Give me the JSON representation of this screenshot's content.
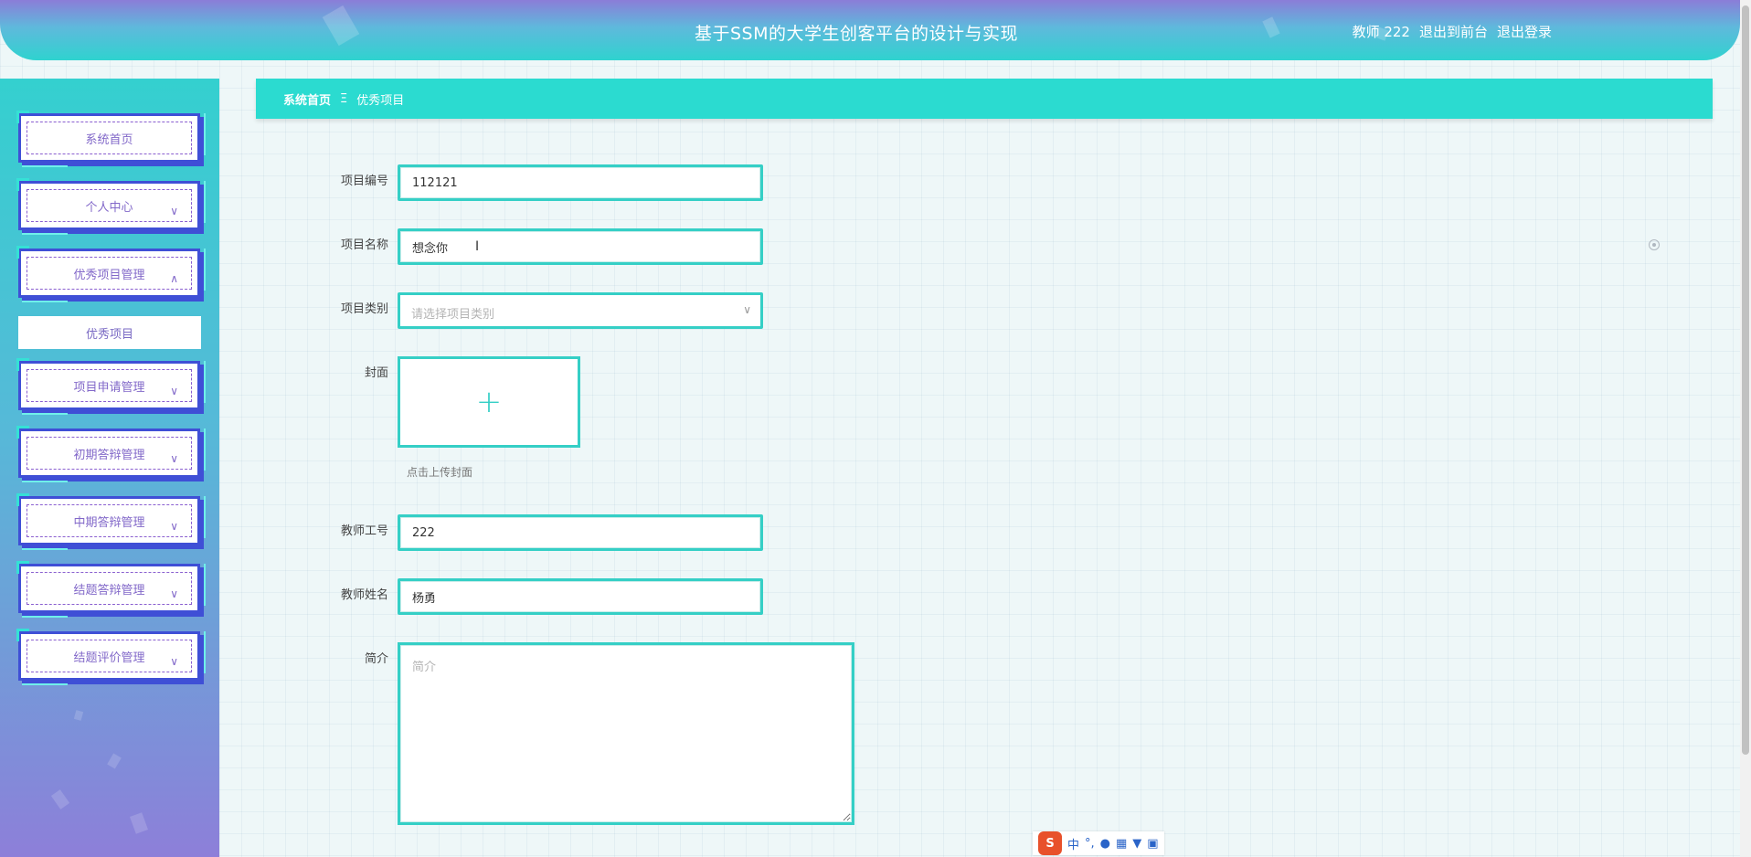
{
  "header": {
    "title": "基于SSM的大学生创客平台的设计与实现",
    "user": "教师 222",
    "to_front": "退出到前台",
    "logout": "退出登录"
  },
  "sidebar": {
    "items": [
      {
        "label": "系统首页",
        "chevron": ""
      },
      {
        "label": "个人中心",
        "chevron": "∨"
      },
      {
        "label": "优秀项目管理",
        "chevron": "∧"
      },
      {
        "label": "项目申请管理",
        "chevron": "∨"
      },
      {
        "label": "初期答辩管理",
        "chevron": "∨"
      },
      {
        "label": "中期答辩管理",
        "chevron": "∨"
      },
      {
        "label": "结题答辩管理",
        "chevron": "∨"
      },
      {
        "label": "结题评价管理",
        "chevron": "∨"
      }
    ],
    "submenu": {
      "label": "优秀项目"
    }
  },
  "breadcrumb": {
    "home": "系统首页",
    "separator": "Ξ",
    "current": "优秀项目"
  },
  "form": {
    "project_no": {
      "label": "项目编号",
      "value": "112121"
    },
    "project_name": {
      "label": "项目名称",
      "value": "想念你"
    },
    "project_type": {
      "label": "项目类别",
      "placeholder": "请选择项目类别"
    },
    "cover": {
      "label": "封面",
      "hint": "点击上传封面"
    },
    "teacher_no": {
      "label": "教师工号",
      "value": "222"
    },
    "teacher_name": {
      "label": "教师姓名",
      "value": "杨勇"
    },
    "intro": {
      "label": "简介",
      "placeholder": "简介"
    }
  },
  "ime": {
    "mode": "中",
    "punct": "°,"
  },
  "colors": {
    "accent": "#35cfc6",
    "breadcrumb_bg": "#2bdbd0",
    "menu_border": "#3f4fd6",
    "menu_text": "#8268c9"
  }
}
